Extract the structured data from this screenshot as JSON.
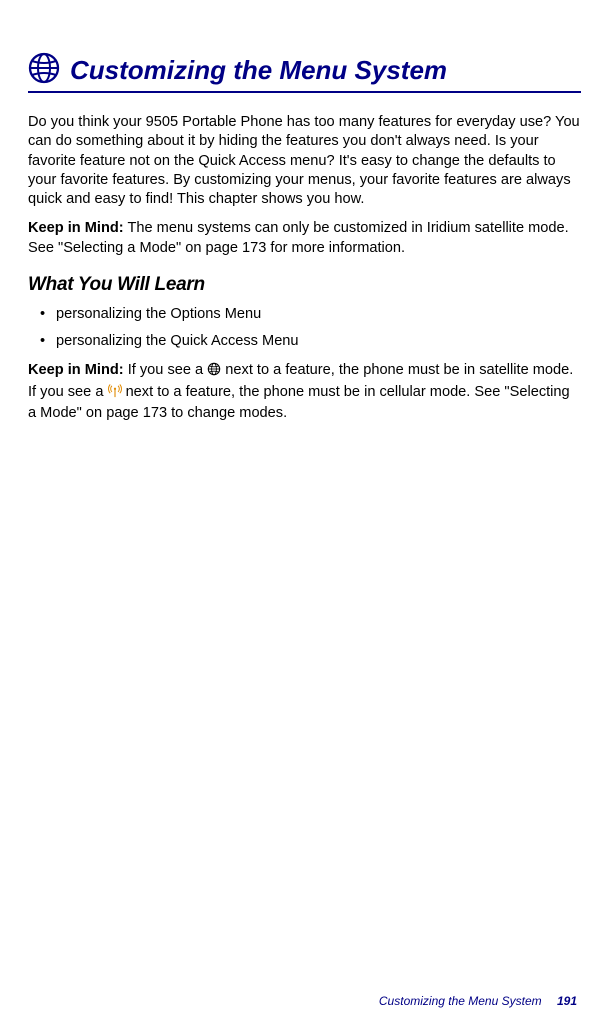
{
  "title": "Customizing the Menu System",
  "intro_paragraph": "Do you think your 9505 Portable Phone has too many features for everyday use? You can do something about it by hiding the features you don't always need. Is your favorite feature not on the Quick Access menu? It's easy to change the defaults to your favorite features. By customizing your menus, your favorite features are always quick and easy to find! This chapter shows you how.",
  "keep_in_mind_1_label": "Keep in Mind:",
  "keep_in_mind_1_text": " The menu systems can only be customized in Iridium satellite mode. See \"Selecting a Mode\" on page 173 for more information.",
  "subtitle": "What You Will Learn",
  "bullets": [
    "personalizing the Options Menu",
    "personalizing the Quick Access Menu"
  ],
  "keep_in_mind_2_label": "Keep in Mind:",
  "keep_in_mind_2_part1": " If you see a ",
  "keep_in_mind_2_part2": " next to a feature, the phone must be in satellite mode. If you see a ",
  "keep_in_mind_2_part3": " next to a feature, the phone must be in cellular mode. See \"Selecting a Mode\" on page 173 to change modes.",
  "footer_text": "Customizing the Menu System",
  "page_number": "191"
}
